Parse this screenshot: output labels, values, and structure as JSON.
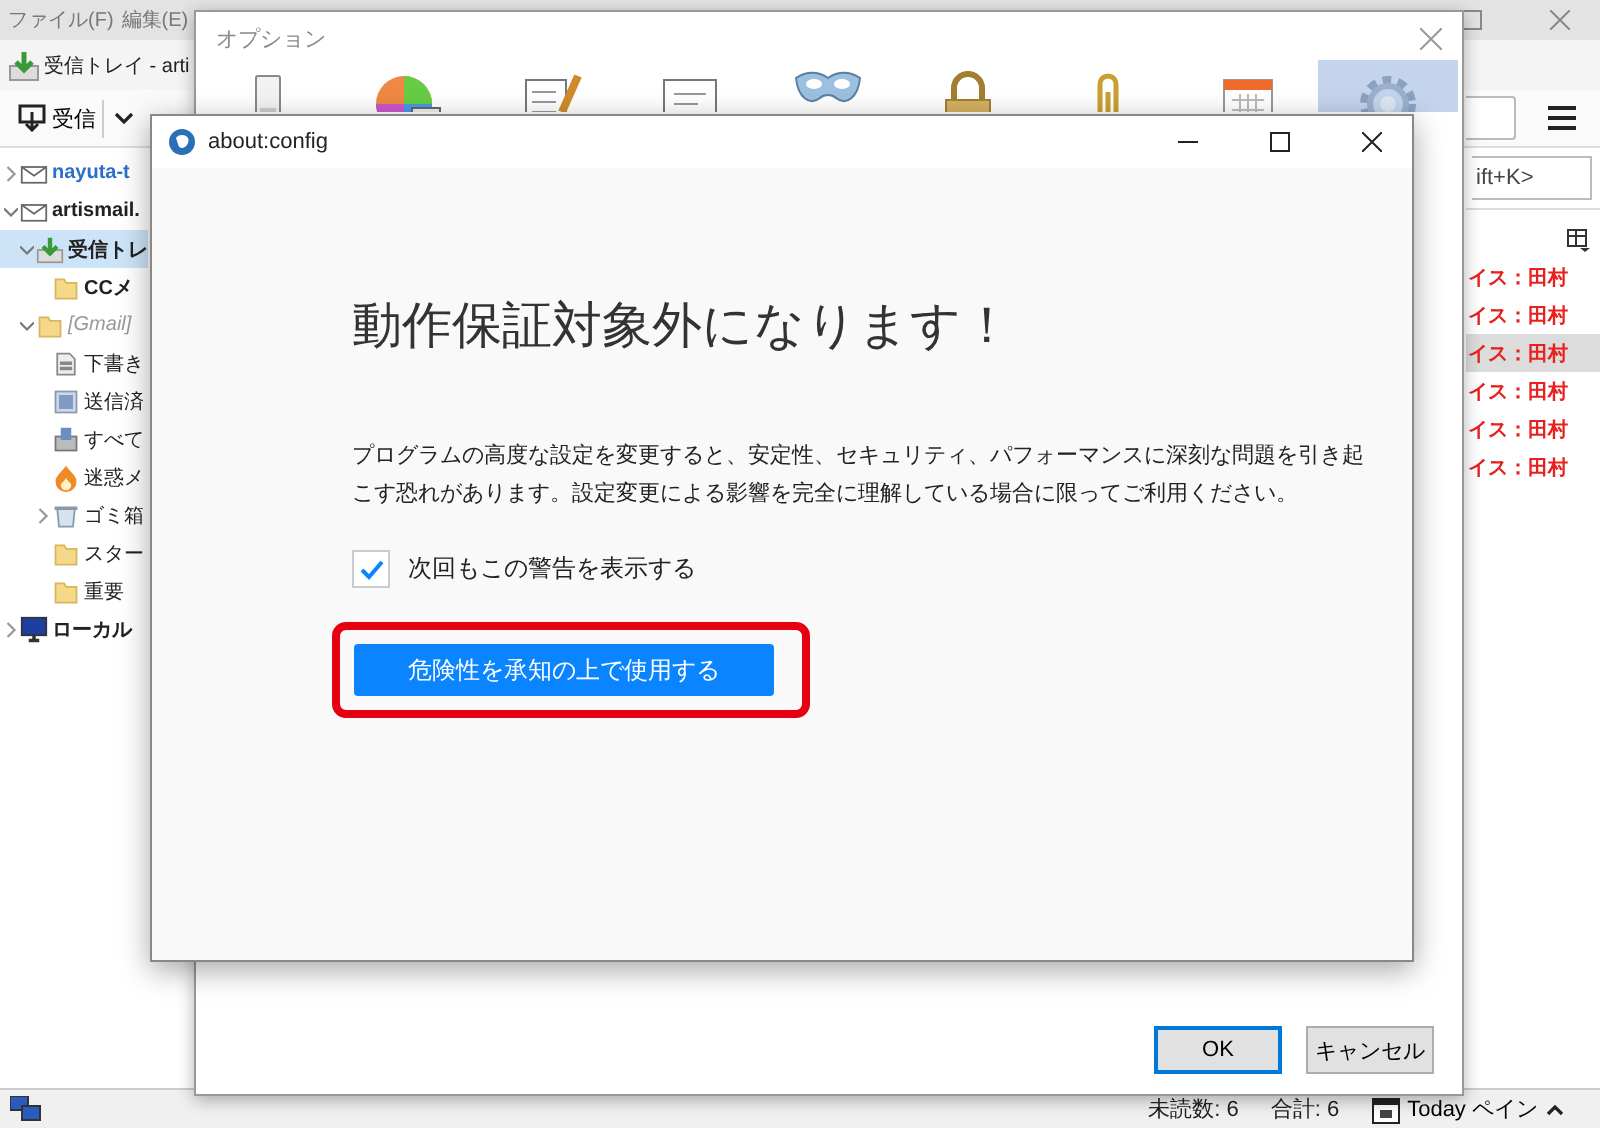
{
  "main_window": {
    "menu": [
      "ファイル(F)",
      "編集(E)"
    ],
    "tab_title": "受信トレイ - arti",
    "toolbar": {
      "get_mail": "受信"
    },
    "quick_filter": {
      "placeholder": "ift+K>"
    },
    "folders": [
      {
        "label": "nayuta-t",
        "kind": "account",
        "expanded": false,
        "selected": false,
        "unread": true,
        "new_mail": true
      },
      {
        "label": "artismail.",
        "kind": "account",
        "expanded": true,
        "selected": false,
        "unread": true,
        "new_mail": false,
        "children": [
          {
            "label": "受信トレ",
            "kind": "inbox",
            "expanded": true,
            "selected": true,
            "unread": true,
            "new_mail": false,
            "children": [
              {
                "label": "CCメ",
                "kind": "folder",
                "selected": false,
                "unread": true,
                "new_mail": false
              }
            ]
          },
          {
            "label": "[Gmail]",
            "kind": "gmail",
            "expanded": true,
            "selected": false,
            "unread": false,
            "new_mail": false,
            "children": [
              {
                "label": "下書き",
                "kind": "drafts",
                "selected": false,
                "unread": false,
                "new_mail": false
              },
              {
                "label": "送信済",
                "kind": "sent",
                "selected": false,
                "unread": false,
                "new_mail": false
              },
              {
                "label": "すべて",
                "kind": "archive",
                "selected": false,
                "unread": false,
                "new_mail": false
              },
              {
                "label": "迷惑メ",
                "kind": "junk",
                "selected": false,
                "unread": false,
                "new_mail": false
              },
              {
                "label": "ゴミ箱",
                "kind": "trash",
                "expanded": false,
                "selected": false,
                "unread": false,
                "new_mail": false
              },
              {
                "label": "スター",
                "kind": "folder",
                "selected": false,
                "unread": false,
                "new_mail": false
              },
              {
                "label": "重要",
                "kind": "folder",
                "selected": false,
                "unread": false,
                "new_mail": false
              }
            ]
          }
        ]
      },
      {
        "label": "ローカル",
        "kind": "local",
        "expanded": false,
        "selected": false,
        "unread": true,
        "new_mail": false
      }
    ],
    "messages": [
      {
        "sender": "イス：田村",
        "selected": false
      },
      {
        "sender": "イス：田村",
        "selected": false
      },
      {
        "sender": "イス：田村",
        "selected": true
      },
      {
        "sender": "イス：田村",
        "selected": false
      },
      {
        "sender": "イス：田村",
        "selected": false
      },
      {
        "sender": "イス：田村",
        "selected": false
      }
    ],
    "status_bar": {
      "unread": "未読数: 6",
      "total": "合計: 6",
      "today_pane": "Today ペイン"
    }
  },
  "options_window": {
    "title": "オプション",
    "panes": [
      {
        "kind": "general",
        "selected": false
      },
      {
        "kind": "display",
        "selected": false
      },
      {
        "kind": "composition",
        "selected": false
      },
      {
        "kind": "chat",
        "selected": false
      },
      {
        "kind": "privacy",
        "selected": false
      },
      {
        "kind": "security",
        "selected": false
      },
      {
        "kind": "attachments",
        "selected": false
      },
      {
        "kind": "calendar",
        "selected": false
      },
      {
        "kind": "advanced",
        "selected": true
      }
    ],
    "buttons": [
      "OK",
      "キャンセル"
    ]
  },
  "config_window": {
    "title": "about:config",
    "heading": "動作保証対象外になります！",
    "warning": "プログラムの高度な設定を変更すると、安定性、セキュリティ、パフォーマンスに深刻な問題を引き起こす恐れがあります。設定変更による影響を完全に理解している場合に限ってご利用ください。",
    "show_warning": {
      "label": "次回もこの警告を表示する",
      "checked": true
    },
    "accept_button": "危険性を承知の上で使用する",
    "highlighted": true
  }
}
